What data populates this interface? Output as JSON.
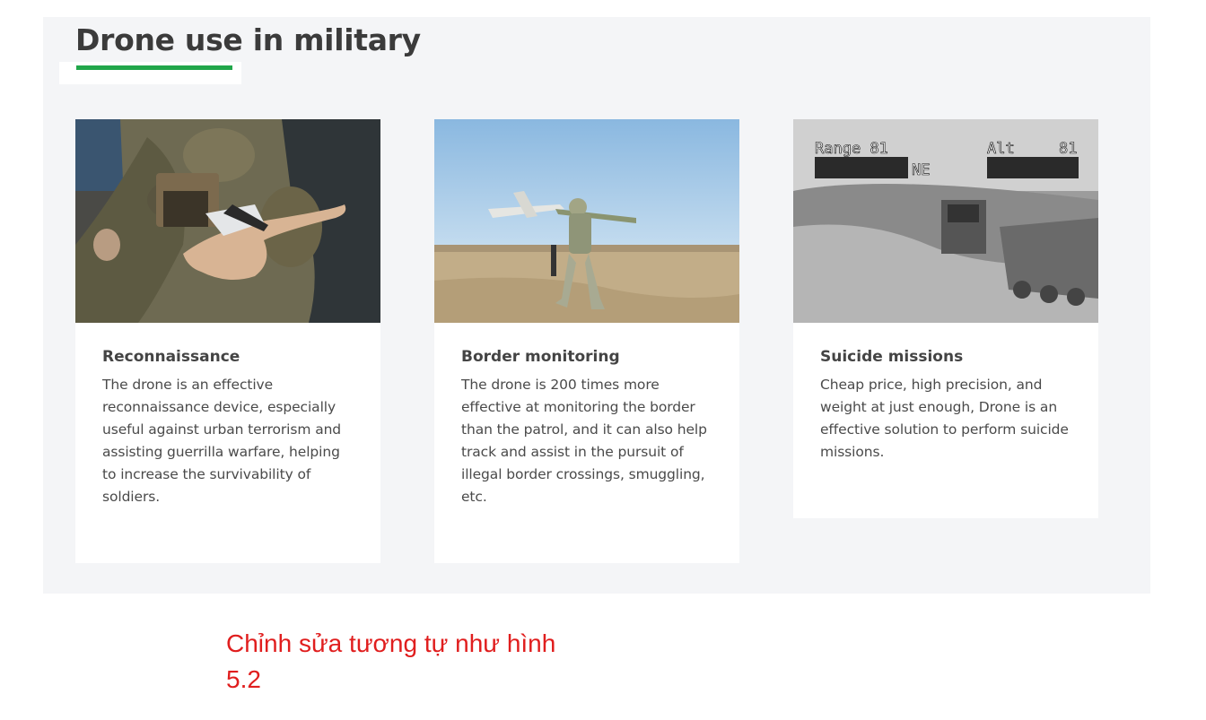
{
  "section": {
    "title": "Drone use in military",
    "accent_color": "#21a64a"
  },
  "cards": [
    {
      "heading": "Reconnaissance",
      "text": "The drone is an effective reconnaissance device, especially useful against urban terrorism and assisting guerrilla warfare, helping to increase the survivability of soldiers.",
      "image": "soldier-holding-nano-drone-image"
    },
    {
      "heading": "Border monitoring",
      "text": "The drone is 200 times more effective at monitoring the border than the patrol, and it can also help track and assist in the pursuit of illegal border crossings, smuggling, etc.",
      "image": "soldier-launching-drone-image"
    },
    {
      "heading": "Suicide missions",
      "text": "Cheap price, high precision, and weight at just enough, Drone is an effective solution to perform suicide missions.",
      "image": "drone-camera-feed-image",
      "hud": {
        "range_label": "Range 81",
        "alt_label": "Alt",
        "alt_value": "81",
        "heading": "NE"
      }
    }
  ],
  "note": {
    "text": "Chỉnh sửa tương tự như hình 5.2",
    "color": "#e01e1e"
  }
}
